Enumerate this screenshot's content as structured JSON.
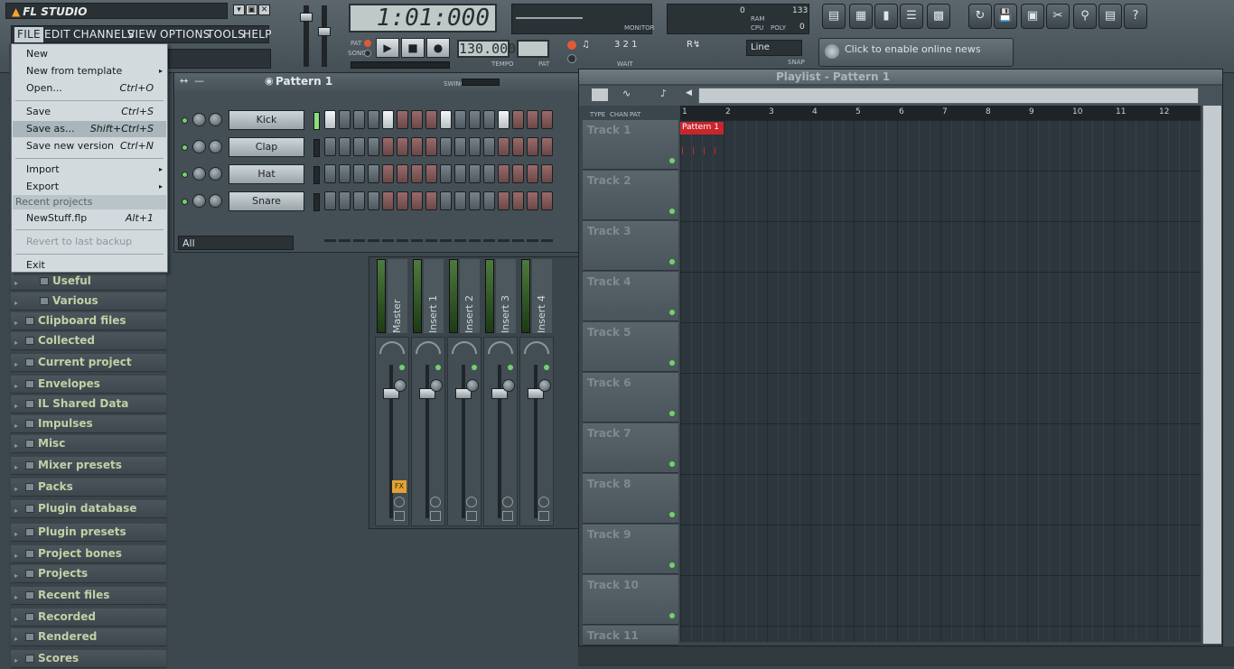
{
  "app": {
    "title": "FL STUDIO",
    "window_buttons": [
      "▾",
      "▣",
      "✕"
    ]
  },
  "menubar": {
    "items": [
      "FILE",
      "EDIT",
      "CHANNELS",
      "VIEW",
      "OPTIONS",
      "TOOLS",
      "HELP"
    ],
    "active": "FILE"
  },
  "transport": {
    "time": "1:01:000",
    "tempo": "130.000",
    "tempo_label": "TEMPO",
    "pat_label": "PAT",
    "pat_song_labels": [
      "PAT",
      "SONG"
    ],
    "monitor_label": "MONITOR",
    "cpu_labels": [
      "RAM",
      "CPU",
      "POLY"
    ],
    "cpu_values": [
      "0",
      "133",
      "0"
    ],
    "wait_label": "WAIT",
    "snap_value": "Line",
    "snap_label": "SNAP"
  },
  "news": {
    "text": "Click to enable online news"
  },
  "file_menu": {
    "items": [
      {
        "label": "New",
        "shortcut": "",
        "submenu": false
      },
      {
        "label": "New from template",
        "shortcut": "",
        "submenu": true
      },
      {
        "label": "Open...",
        "shortcut": "Ctrl+O",
        "submenu": false
      },
      {
        "label": "Save",
        "shortcut": "Ctrl+S",
        "submenu": false
      },
      {
        "label": "Save as...",
        "shortcut": "Shift+Ctrl+S",
        "submenu": false
      },
      {
        "label": "Save new version",
        "shortcut": "Ctrl+N",
        "submenu": false
      },
      {
        "label": "Import",
        "shortcut": "",
        "submenu": true
      },
      {
        "label": "Export",
        "shortcut": "",
        "submenu": true
      },
      {
        "label": "NewStuff.flp",
        "shortcut": "Alt+1",
        "submenu": false
      },
      {
        "label": "Revert to last backup",
        "shortcut": "",
        "submenu": false
      },
      {
        "label": "Exit",
        "shortcut": "",
        "submenu": false
      }
    ],
    "recent_header": "Recent projects",
    "highlighted": "Save as..."
  },
  "browser": {
    "items": [
      "Useful",
      "Various",
      "Clipboard files",
      "Collected",
      "Current project",
      "Envelopes",
      "IL Shared Data",
      "Impulses",
      "Misc",
      "Mixer presets",
      "Packs",
      "Plugin database",
      "Plugin presets",
      "Project bones",
      "Projects",
      "Recent files",
      "Recorded",
      "Rendered",
      "Scores"
    ]
  },
  "step_sequencer": {
    "pattern": "Pattern 1",
    "swing_label": "SWING",
    "filter": "All",
    "channels": [
      {
        "name": "Kick",
        "steps": [
          1,
          0,
          0,
          0,
          1,
          0,
          0,
          0,
          1,
          0,
          0,
          0,
          1,
          0,
          0,
          0
        ]
      },
      {
        "name": "Clap",
        "steps": [
          0,
          0,
          0,
          0,
          0,
          0,
          0,
          0,
          0,
          0,
          0,
          0,
          0,
          0,
          0,
          0
        ]
      },
      {
        "name": "Hat",
        "steps": [
          0,
          0,
          0,
          0,
          0,
          0,
          0,
          0,
          0,
          0,
          0,
          0,
          0,
          0,
          0,
          0
        ]
      },
      {
        "name": "Snare",
        "steps": [
          0,
          0,
          0,
          0,
          0,
          0,
          0,
          0,
          0,
          0,
          0,
          0,
          0,
          0,
          0,
          0
        ]
      }
    ]
  },
  "mixer": {
    "channels": [
      "Master",
      "Insert 1",
      "Insert 2",
      "Insert 3",
      "Insert 4"
    ],
    "fx_label": "FX"
  },
  "playlist": {
    "title": "Playlist - Pattern 1",
    "header_labels": [
      "TYPE",
      "CHAN",
      "PAT"
    ],
    "bars": [
      "1",
      "2",
      "3",
      "4",
      "5",
      "6",
      "7",
      "8",
      "9",
      "10",
      "11",
      "12"
    ],
    "tracks": [
      "Track 1",
      "Track 2",
      "Track 3",
      "Track 4",
      "Track 5",
      "Track 6",
      "Track 7",
      "Track 8",
      "Track 9",
      "Track 10",
      "Track 11"
    ],
    "clip_label": "Pattern 1"
  }
}
